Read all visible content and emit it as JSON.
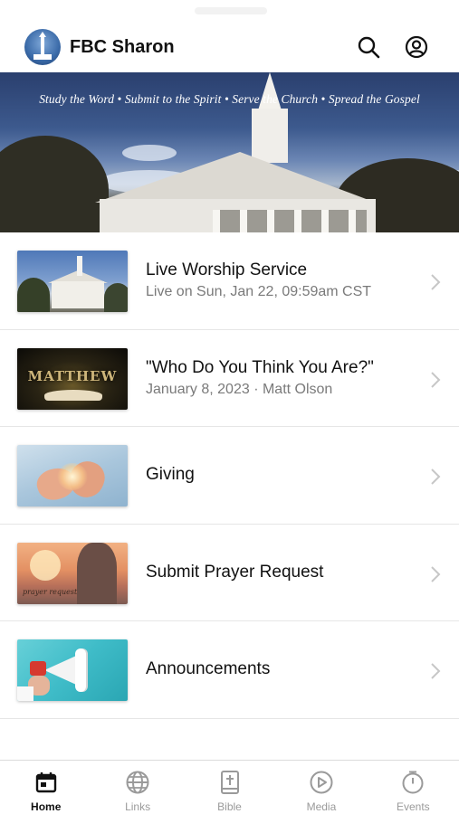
{
  "header": {
    "title": "FBC Sharon",
    "logo_icon": "church-steeple-logo",
    "search_icon": "search-icon",
    "account_icon": "account-circle-icon"
  },
  "hero": {
    "tagline": "Study the Word • Submit to the Spirit • Serve the Church • Spread the Gospel"
  },
  "items": [
    {
      "title": "Live Worship Service",
      "subtitle": "Live on Sun, Jan 22, 09:59am CST",
      "thumb": "church-photo"
    },
    {
      "title": "\"Who Do You Think You Are?\"",
      "subtitle": "January 8, 2023 · Matt Olson",
      "thumb": "matthew-bible"
    },
    {
      "title": "Giving",
      "subtitle": "",
      "thumb": "hands-light"
    },
    {
      "title": "Submit Prayer Request",
      "subtitle": "",
      "thumb": "praying-hands",
      "thumb_caption": "prayer request"
    },
    {
      "title": "Announcements",
      "subtitle": "",
      "thumb": "megaphone"
    }
  ],
  "thumb_text": {
    "matthew": "MATTHEW"
  },
  "tabs": [
    {
      "label": "Home",
      "icon": "calendar-home-icon",
      "active": true
    },
    {
      "label": "Links",
      "icon": "globe-icon",
      "active": false
    },
    {
      "label": "Bible",
      "icon": "bible-book-icon",
      "active": false
    },
    {
      "label": "Media",
      "icon": "play-circle-icon",
      "active": false
    },
    {
      "label": "Events",
      "icon": "clock-icon",
      "active": false
    }
  ],
  "colors": {
    "active_tab": "#111111",
    "inactive_tab": "#9a9a9a",
    "subtitle": "#7a7a7a",
    "chevron": "#c7c7c7"
  }
}
